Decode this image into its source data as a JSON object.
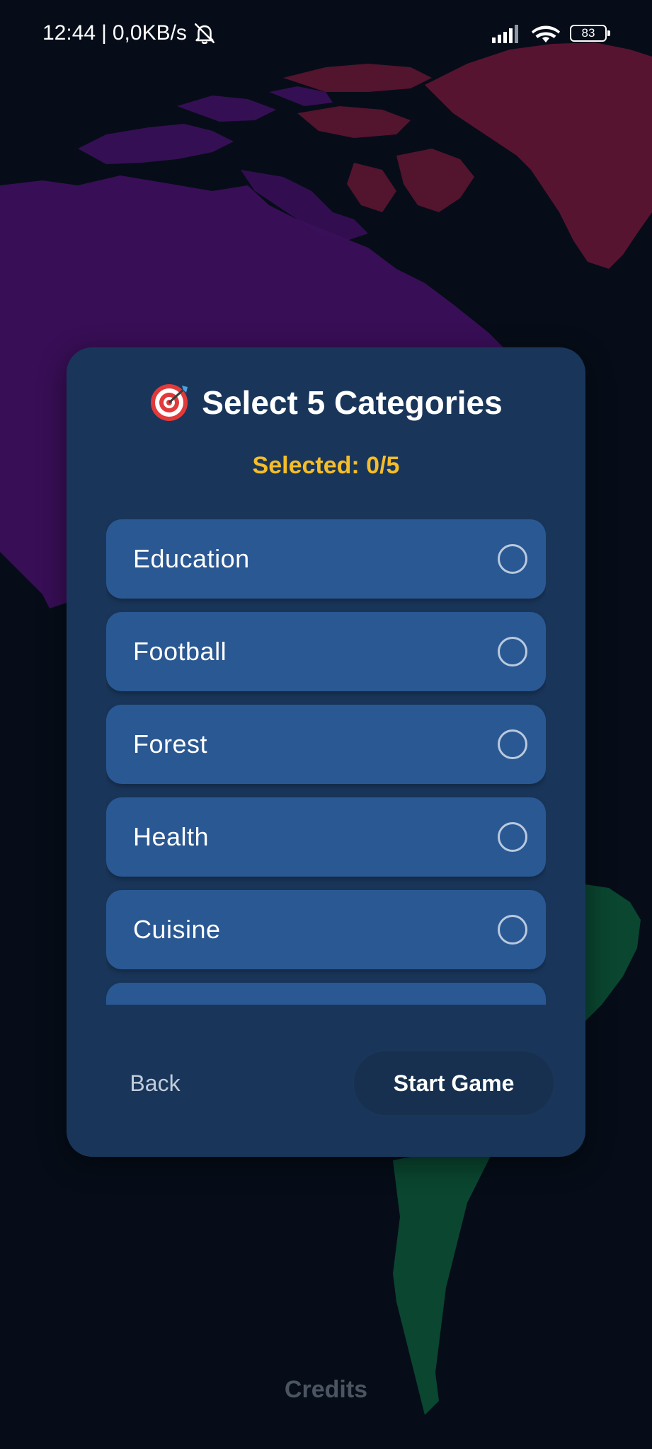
{
  "status_bar": {
    "time": "12:44",
    "network_speed": "0,0KB/s",
    "separator": "|",
    "battery": "83",
    "icons": [
      "bell-off-icon",
      "signal-icon",
      "wifi-icon",
      "battery-icon"
    ]
  },
  "dialog": {
    "title_icon": "target-icon",
    "title": "Select 5 Categories",
    "selected_label": "Selected: 0/5",
    "categories": [
      {
        "label": "Education",
        "selected": false
      },
      {
        "label": "Football",
        "selected": false
      },
      {
        "label": "Forest",
        "selected": false
      },
      {
        "label": "Health",
        "selected": false
      },
      {
        "label": "Cuisine",
        "selected": false
      },
      {
        "label": "",
        "selected": false
      }
    ],
    "back_label": "Back",
    "start_label": "Start Game"
  },
  "footer": {
    "credits_label": "Credits"
  },
  "colors": {
    "background": "#060d18",
    "dialog": "#19365a",
    "list_item": "#2a5893",
    "accent_yellow": "#f5bd28",
    "map_purple": "#3d0f5e",
    "map_red": "#5e1530",
    "map_green": "#0a4a32"
  }
}
